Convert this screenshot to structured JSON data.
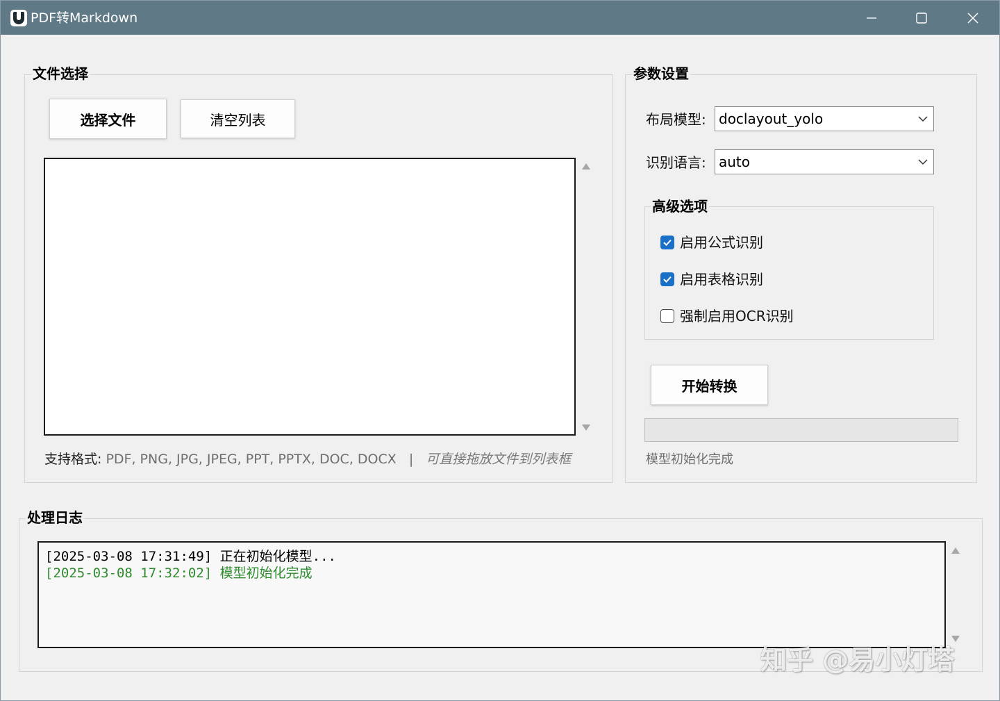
{
  "window": {
    "title": "PDF转Markdown",
    "icon": "app-logo-icon"
  },
  "file_section": {
    "title": "文件选择",
    "select_button": "选择文件",
    "clear_button": "清空列表",
    "files": [],
    "formats_label": "支持格式:",
    "formats_value": "PDF, PNG, JPG, JPEG, PPT, PPTX, DOC, DOCX",
    "separator": "|",
    "drag_hint": "可直接拖放文件到列表框"
  },
  "params_section": {
    "title": "参数设置",
    "layout_model_label": "布局模型:",
    "layout_model_value": "doclayout_yolo",
    "language_label": "识别语言:",
    "language_value": "auto",
    "advanced": {
      "title": "高级选项",
      "options": [
        {
          "label": "启用公式识别",
          "checked": true
        },
        {
          "label": "启用表格识别",
          "checked": true
        },
        {
          "label": "强制启用OCR识别",
          "checked": false
        }
      ]
    },
    "start_button": "开始转换",
    "progress": 0,
    "status": "模型初始化完成"
  },
  "log_section": {
    "title": "处理日志",
    "entries": [
      {
        "text": "[2025-03-08 17:31:49] 正在初始化模型...",
        "color": "#000000"
      },
      {
        "text": "[2025-03-08 17:32:02] 模型初始化完成",
        "color": "#2e8b2e"
      }
    ]
  },
  "watermark": "知乎 @易小灯塔",
  "colors": {
    "titlebar": "#607986",
    "checkbox_accent": "#1a6fc7",
    "log_success": "#2e8b2e"
  }
}
